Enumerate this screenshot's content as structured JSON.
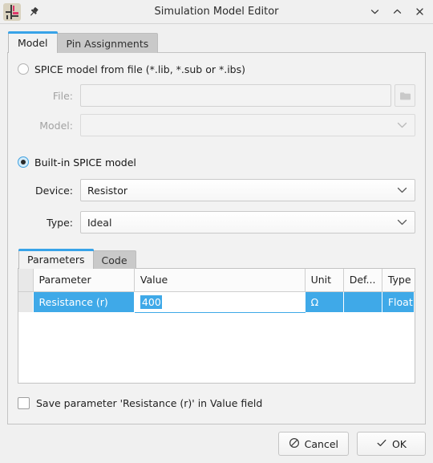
{
  "titlebar": {
    "title": "Simulation Model Editor",
    "app_icon": "kicad-simulation-icon",
    "pin_icon": "pin-icon",
    "controls": [
      {
        "name": "minimize-button",
        "icon": "chevron-down-icon"
      },
      {
        "name": "maximize-button",
        "icon": "chevron-up-icon"
      },
      {
        "name": "close-button",
        "icon": "close-icon"
      }
    ]
  },
  "tabs": [
    {
      "label": "Model",
      "active": true
    },
    {
      "label": "Pin Assignments",
      "active": false
    }
  ],
  "model": {
    "from_file": {
      "radio_label": "SPICE model from file (*.lib, *.sub or *.ibs)",
      "selected": false,
      "file_label": "File:",
      "file_value": "",
      "file_placeholder": "",
      "browse_icon": "folder-icon",
      "model_label": "Model:",
      "model_value": "",
      "model_chevron": "chevron-down-icon"
    },
    "builtin": {
      "radio_label": "Built-in SPICE model",
      "selected": true,
      "device_label": "Device:",
      "device_value": "Resistor",
      "device_chevron": "chevron-down-icon",
      "type_label": "Type:",
      "type_value": "Ideal",
      "type_chevron": "chevron-down-icon"
    }
  },
  "param_group": {
    "tabs": [
      {
        "label": "Parameters",
        "active": true
      },
      {
        "label": "Code",
        "active": false
      }
    ],
    "columns": [
      "Parameter",
      "Value",
      "Unit",
      "Def...",
      "Type"
    ],
    "rows": [
      {
        "parameter": "Resistance (r)",
        "value": "400",
        "unit": "Ω",
        "default": "",
        "type": "Float",
        "selected": true,
        "value_editing": true,
        "value_text_selected": true
      }
    ]
  },
  "save_param": {
    "label": "Save parameter 'Resistance (r)' in Value field",
    "checked": false
  },
  "buttons": {
    "cancel": {
      "label": "Cancel",
      "icon": "no-entry-icon"
    },
    "ok": {
      "label": "OK",
      "icon": "check-icon"
    }
  },
  "colors": {
    "accent": "#38a3e8",
    "selection": "#3fa9e8",
    "window_bg": "#f0f0f0",
    "panel_bg": "#f2f2f2"
  }
}
